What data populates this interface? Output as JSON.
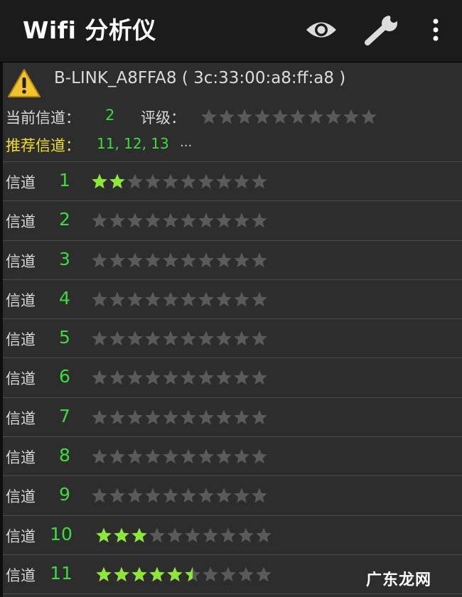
{
  "app": {
    "title": "Wifi 分析仪"
  },
  "toolbar": {
    "view_icon": "eye-icon",
    "settings_icon": "wrench-icon",
    "menu_icon": "more-vertical-icon"
  },
  "network": {
    "warning_icon": "warning-triangle-icon",
    "ssid_line": "B-LINK_A8FFA8 ( 3c:33:00:a8:ff:a8 )"
  },
  "current": {
    "label": "当前信道：",
    "channel": "2",
    "rating_label": "评级：",
    "rating_stars": 0,
    "max_stars": 10
  },
  "recommended": {
    "label": "推荐信道：",
    "channels": "11, 12, 13",
    "more": "..."
  },
  "channels": [
    {
      "label": "信道",
      "number": "1",
      "rating": 2
    },
    {
      "label": "信道",
      "number": "2",
      "rating": 0
    },
    {
      "label": "信道",
      "number": "3",
      "rating": 0
    },
    {
      "label": "信道",
      "number": "4",
      "rating": 0
    },
    {
      "label": "信道",
      "number": "5",
      "rating": 0
    },
    {
      "label": "信道",
      "number": "6",
      "rating": 0
    },
    {
      "label": "信道",
      "number": "7",
      "rating": 0
    },
    {
      "label": "信道",
      "number": "8",
      "rating": 0
    },
    {
      "label": "信道",
      "number": "9",
      "rating": 0
    },
    {
      "label": "信道",
      "number": "10",
      "rating": 3
    },
    {
      "label": "信道",
      "number": "11",
      "rating": 5.5
    }
  ],
  "colors": {
    "accent_green": "#3ddc3d",
    "recommend_yellow": "#f0e020",
    "star_on": "#8fe63a",
    "star_off": "#5a5a5a"
  },
  "watermark": {
    "text": "广东龙网"
  }
}
